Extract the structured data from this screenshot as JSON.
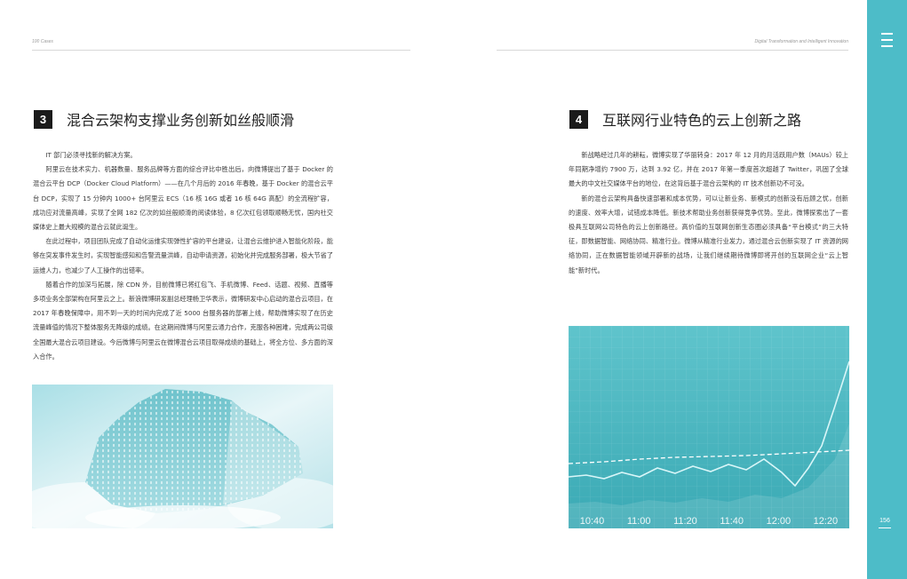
{
  "header": {
    "left": "100 Cases",
    "right": "Digital Transformation and Intelligent Innovation"
  },
  "sidebar": {
    "page_number": "156",
    "menu_icon": "hamburger-icon",
    "color": "#4dbcc8"
  },
  "left": {
    "section_number": "3",
    "section_title": "混合云架构支撑业务创新如丝般顺滑",
    "paragraphs": [
      "IT 部门必须寻找新的解决方案。",
      "阿里云在技术实力、机器数量、服务品牌等方面的综合评比中胜出后，向微博提出了基于 Docker 的混合云平台 DCP（Docker Cloud Platform）——在几个月后的 2016 年春晚，基于 Docker 的混合云平台 DCP，实现了 15 分钟内 1000+ 台阿里云 ECS（16 核 16G 或者 16 核 64G 高配）的全流程扩容，成功应对流量高峰，实现了全网 182 亿次的如丝般顺滑的阅读体验，8 亿次红包领取顺畅无忧，国内社交媒体史上最大规模的混合云就此诞生。",
      "在此过程中，项目团队完成了自动化运维实现弹性扩容的平台建设，让混合云维护进入智能化阶段，能够在突发事件发生时，实现智能感知和告警流量洪峰，自动申请资源，初始化并完成服务部署，极大节省了运维人力，也减少了人工操作的出错率。",
      "随着合作的加深与拓展，除 CDN 外，目前微博已将红包飞、手机微博、Feed、话题、视频、直播等多项业务全部架构在阿里云之上。新浪微博研发副总经理杨卫华表示，微博研发中心启动的混合云项目，在 2017 年春晚保障中，用不到一天的时间内完成了近 5000 台服务器的部署上线，帮助微博实现了在历史流量峰值的情况下整体服务无降级的成绩。在这期间微博与阿里云通力合作，克服各种困难，完成两公司级全国最大混合云项目建设。今后微博与阿里云在微博混合云项目取得成绩的基础上，将全方位、多方面的深入合作。"
    ]
  },
  "right": {
    "section_number": "4",
    "section_title": "互联网行业特色的云上创新之路",
    "paragraphs": [
      "新战略经过几年的耕耘，微博实现了华丽转身：2017 年 12 月的月活跃用户数（MAUs）较上年同期净增约 7900 万，达到 3.92 亿，并在 2017 年第一季度首次超越了 Twitter，巩固了全球最大的中文社交媒体平台的地位，在这背后基于混合云架构的 IT 技术创新功不可没。",
      "新的混合云架构具备快速部署和成本优势，可以让新业务、新模式的创新没有后顾之忧，创新的速度、效率大增，试错成本降低。新技术帮助业务创新获得竞争优势。至此，微博探索出了一套极具互联网公司特色的云上创新路径。高价值的互联网创新生态圈必须具备“平台模式”的三大特征，即数据智能、网络协同、精准行业。微博从精准行业发力，通过混合云创新实现了 IT 资源的网络协同，正在数据智能领域开辟新的战场，让我们继续期待微博即将开创的互联网企业“云上智能”新时代。"
    ],
    "chart_times": [
      "10:40",
      "11:00",
      "11:20",
      "11:40",
      "12:00",
      "12:20"
    ]
  }
}
